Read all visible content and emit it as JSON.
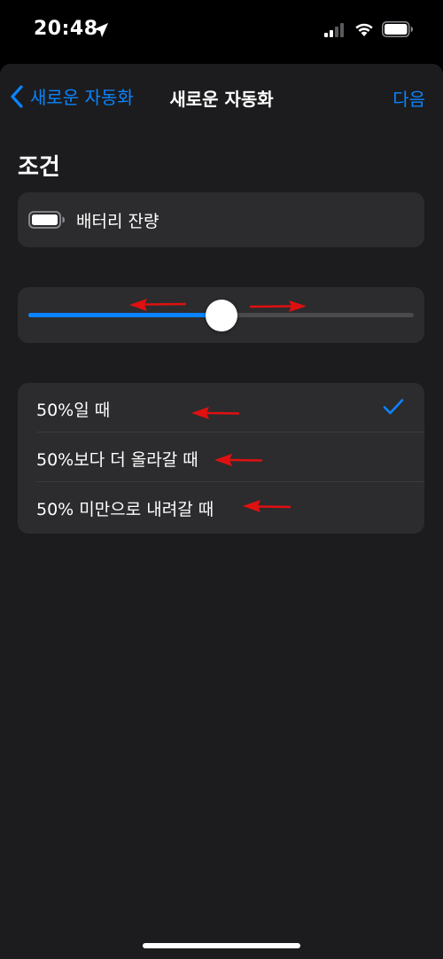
{
  "status_bar": {
    "time": "20:48"
  },
  "nav": {
    "back_label": "새로운 자동화",
    "title": "새로운 자동화",
    "next_label": "다음"
  },
  "section": {
    "title": "조건"
  },
  "trigger": {
    "label": "배터리 잔량",
    "icon": "battery-icon"
  },
  "slider": {
    "value_percent": 50
  },
  "options": [
    {
      "label": "50%일 때",
      "selected": true
    },
    {
      "label": "50%보다 더 올라갈 때",
      "selected": false
    },
    {
      "label": "50% 미만으로 내려갈 때",
      "selected": false
    }
  ],
  "colors": {
    "accent": "#0a84ff",
    "annotation_arrow": "#e01010",
    "sheet_background": "#1c1c1e",
    "card_background": "#2c2c2e"
  }
}
